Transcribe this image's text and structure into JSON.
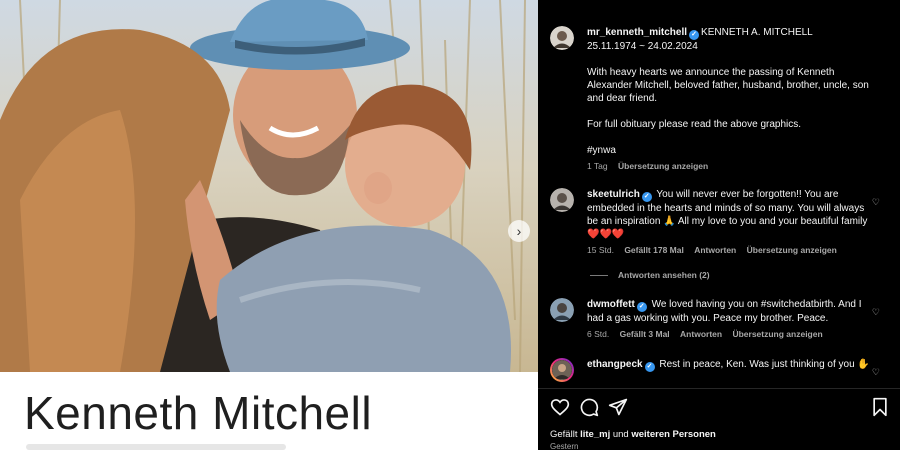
{
  "media": {
    "photo_alt": "",
    "name_title": "Kenneth Mitchell"
  },
  "post": {
    "username": "mr_kenneth_mitchell",
    "display_name": "KENNETH A. MITCHELL",
    "dates": "25.11.1974 ~ 24.02.2024",
    "caption_p1": "With heavy hearts we announce the passing of Kenneth Alexander Mitchell, beloved father, husband, brother, uncle, son and dear friend.",
    "caption_p2": "For full obituary please read the above graphics.",
    "caption_p3": "#ynwa",
    "time": "1 Tag",
    "translate": "Übersetzung anzeigen"
  },
  "comments": [
    {
      "username": "skeetulrich",
      "text": "You will never ever be forgotten!! You are embedded in the hearts and minds of so many. You will always be an inspiration 🙏 All my love to you and your beautiful family ❤️❤️❤️",
      "time": "15 Std.",
      "likes": "Gefällt 178 Mal",
      "reply": "Antworten",
      "translate": "Übersetzung anzeigen",
      "view_replies": "Antworten ansehen (2)"
    },
    {
      "username": "dwmoffett",
      "text": "We loved having you on #switchedatbirth. And I had a gas working with you. Peace my brother. Peace.",
      "time": "6 Std.",
      "likes": "Gefällt 3 Mal",
      "reply": "Antworten",
      "translate": "Übersetzung anzeigen"
    },
    {
      "username": "ethangpeck",
      "text": "Rest in peace, Ken. Was just thinking of you ✋"
    }
  ],
  "actions": {
    "liked_prefix": "Gefällt",
    "liked_user": "lite_mj",
    "liked_join": "und",
    "liked_others": "weiteren Personen",
    "date": "Gestern"
  },
  "icons": {
    "verified": "verified-badge-icon",
    "heart": "heart-icon",
    "comment": "comment-icon",
    "share": "share-icon",
    "save": "bookmark-icon",
    "next": "chevron-right-icon"
  },
  "colors": {
    "verified": "#3797f0",
    "background": "#000000",
    "muted": "#a8a8a8"
  }
}
